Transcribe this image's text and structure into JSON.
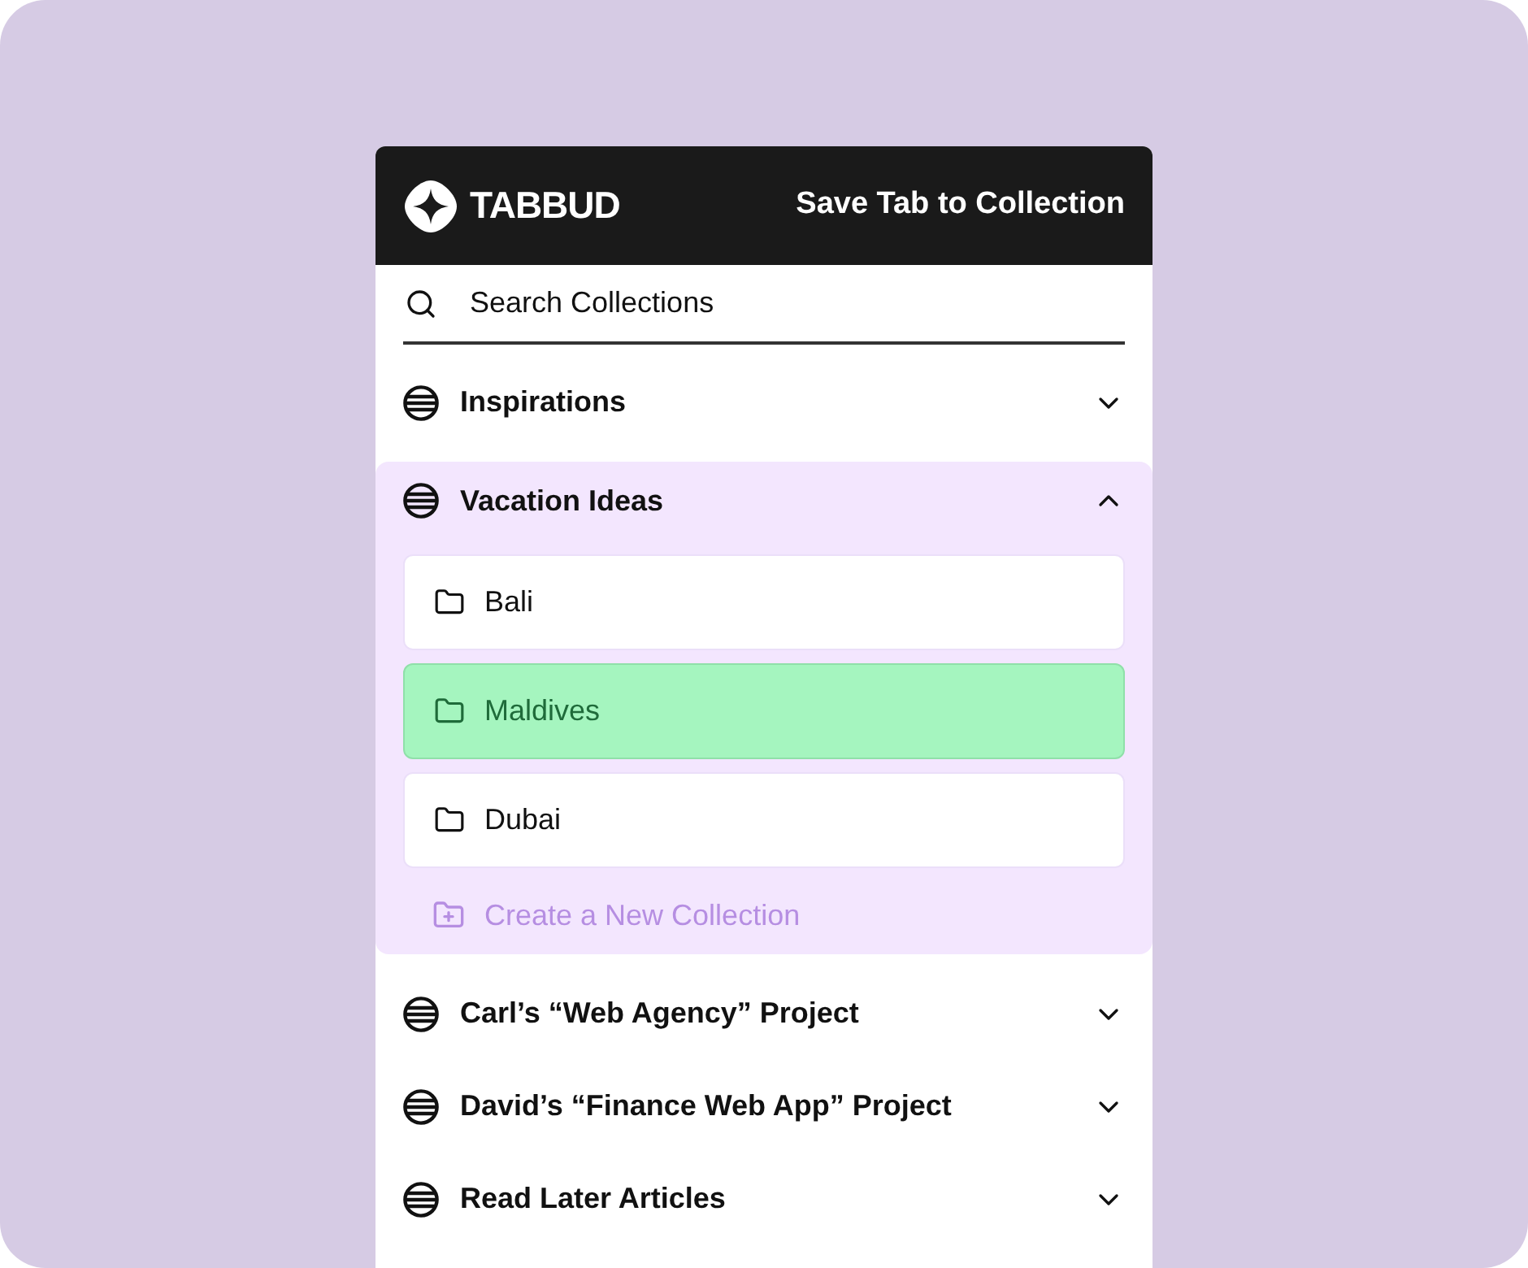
{
  "header": {
    "brand": "TABBUD",
    "title": "Save Tab to Collection"
  },
  "search": {
    "placeholder": "Search Collections"
  },
  "collections": [
    {
      "name": "Inspirations",
      "expanded": false
    },
    {
      "name": "Vacation Ideas",
      "expanded": true,
      "folders": [
        {
          "name": "Bali",
          "selected": false
        },
        {
          "name": "Maldives",
          "selected": true
        },
        {
          "name": "Dubai",
          "selected": false
        }
      ],
      "create_label": "Create a New Collection"
    },
    {
      "name": "Carl’s “Web Agency” Project",
      "expanded": false
    },
    {
      "name": "David’s “Finance Web App” Project",
      "expanded": false
    },
    {
      "name": "Read Later Articles",
      "expanded": false
    }
  ]
}
